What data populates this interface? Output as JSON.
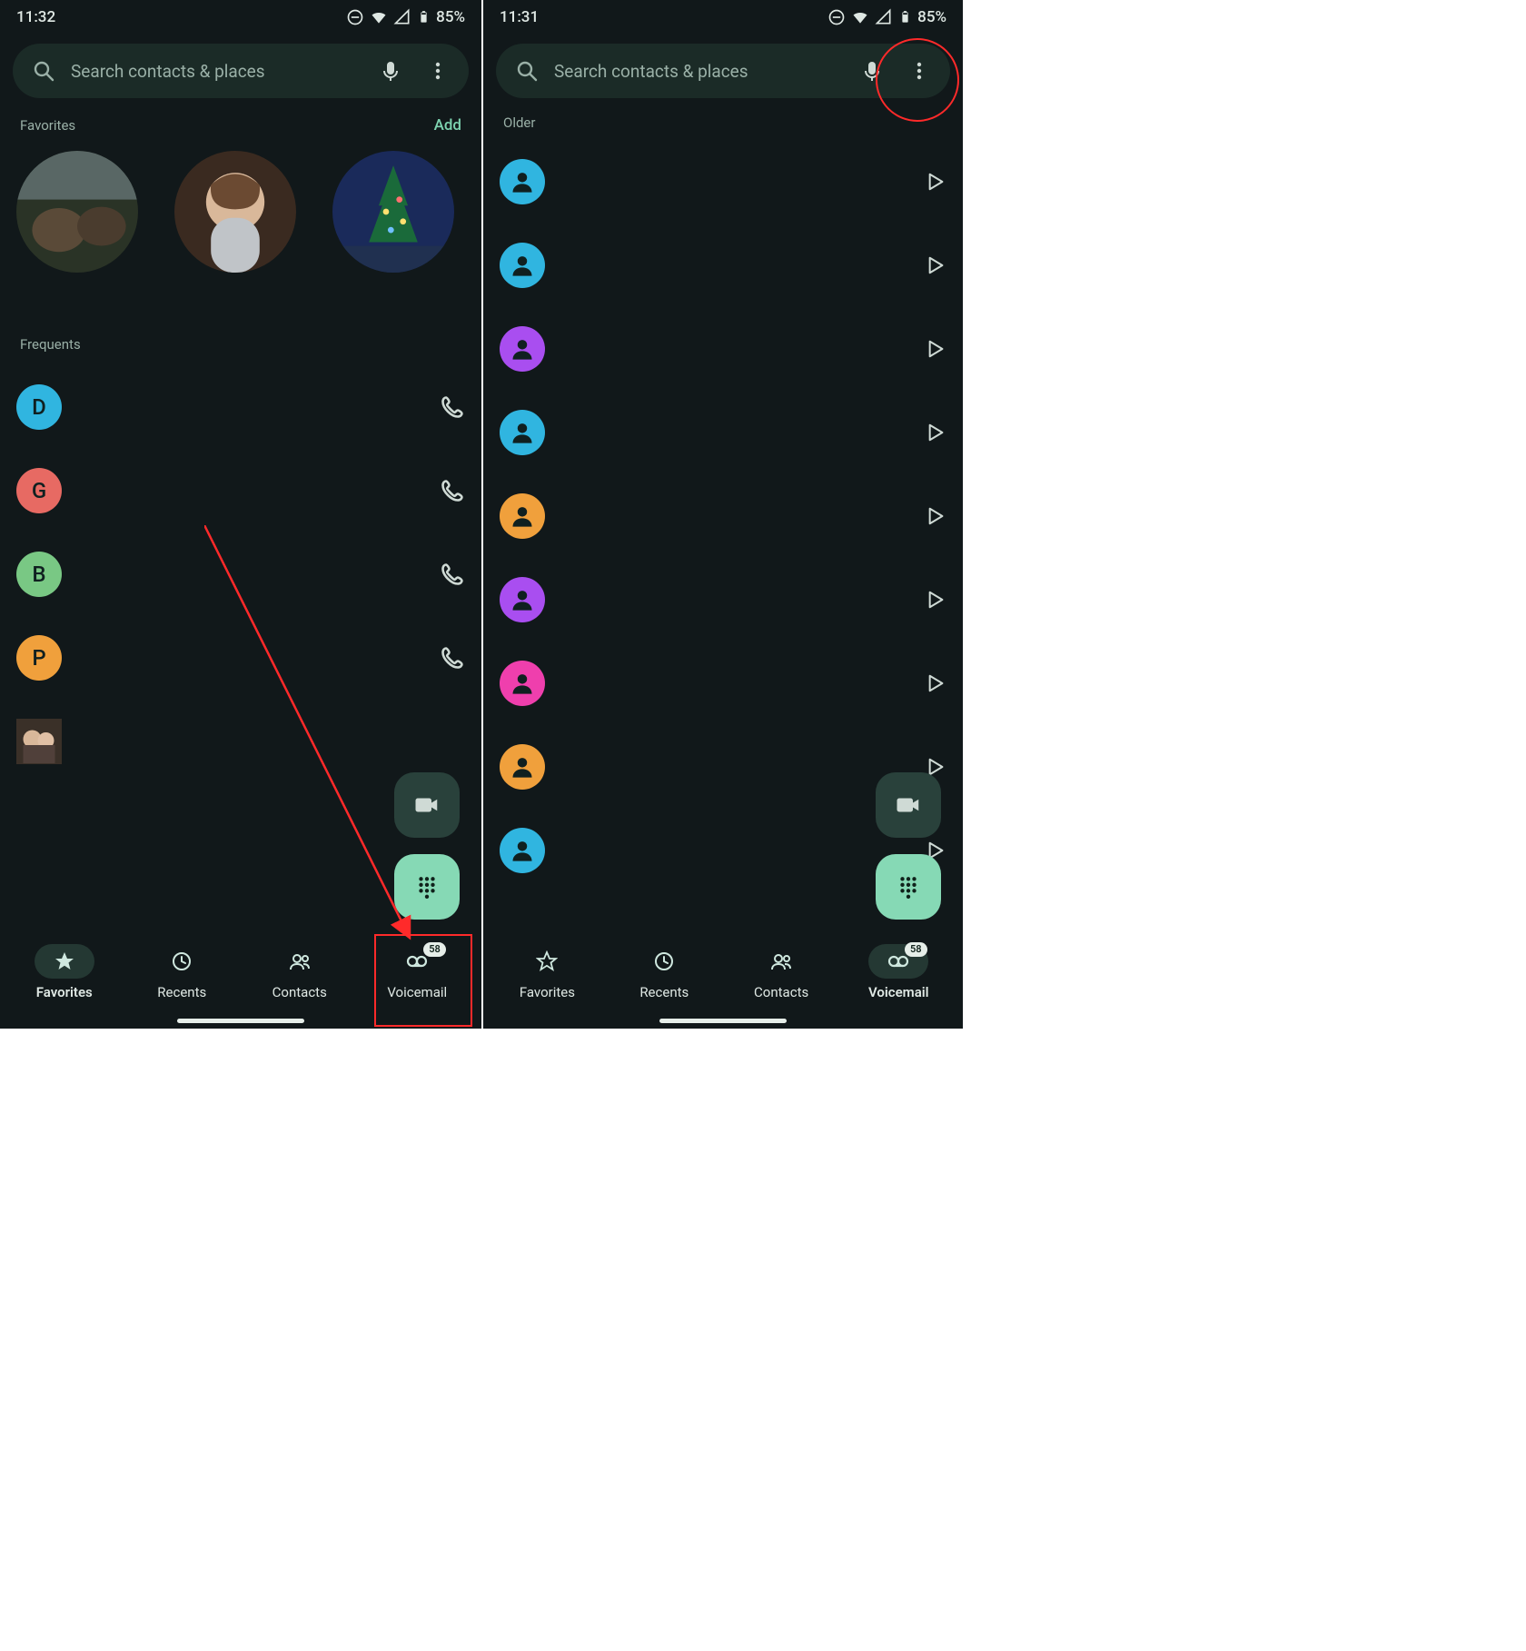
{
  "left": {
    "status": {
      "time": "11:32",
      "battery": "85%"
    },
    "search": {
      "placeholder": "Search contacts & places"
    },
    "favorites": {
      "label": "Favorites",
      "add": "Add"
    },
    "frequents": {
      "label": "Frequents"
    },
    "freq_items": [
      {
        "letter": "D",
        "color": "#30b5e0"
      },
      {
        "letter": "G",
        "color": "#e76a63"
      },
      {
        "letter": "B",
        "color": "#79c884"
      },
      {
        "letter": "P",
        "color": "#f0a03c"
      }
    ],
    "nav": {
      "favorites": "Favorites",
      "recents": "Recents",
      "contacts": "Contacts",
      "voicemail": "Voicemail",
      "badge": "58"
    }
  },
  "right": {
    "status": {
      "time": "11:31",
      "battery": "85%"
    },
    "search": {
      "placeholder": "Search contacts & places"
    },
    "older": "Older",
    "vm_colors": [
      "#30b5e0",
      "#30b5e0",
      "#a94ef0",
      "#30b5e0",
      "#f0a03c",
      "#a94ef0",
      "#ef3fad",
      "#f0a03c",
      "#30b5e0"
    ],
    "nav": {
      "favorites": "Favorites",
      "recents": "Recents",
      "contacts": "Contacts",
      "voicemail": "Voicemail",
      "badge": "58"
    }
  }
}
